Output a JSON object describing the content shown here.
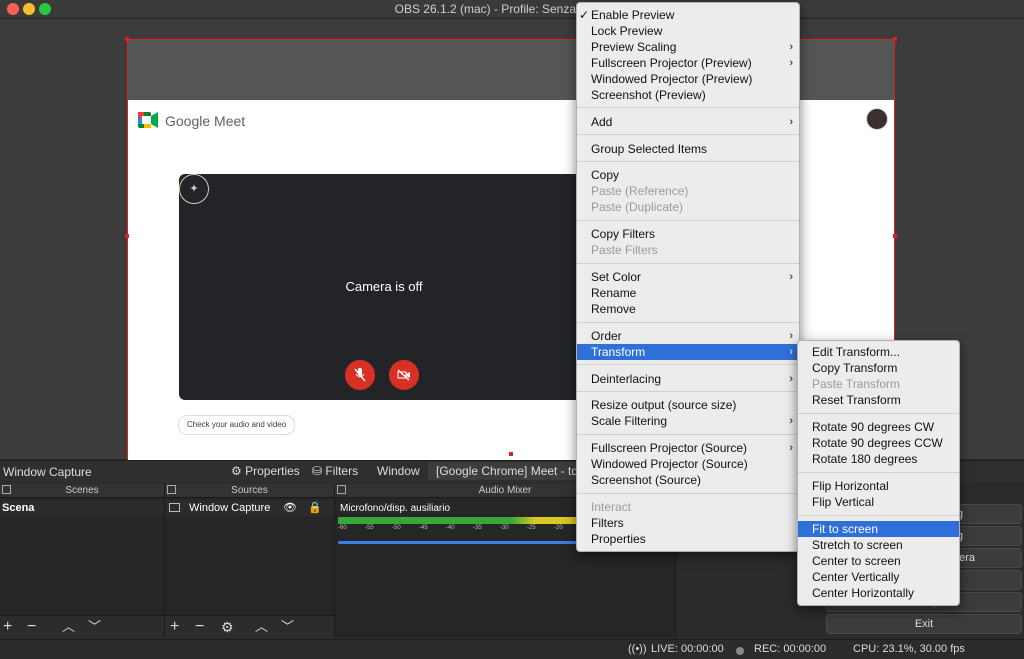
{
  "window": {
    "title": "OBS 26.1.2 (mac) - Profile: Senza titolo - Sc"
  },
  "preview": {
    "meet_name": "Google Meet",
    "camera_off": "Camera is off",
    "check_audio": "Check your audio and video"
  },
  "toolbar": {
    "source_name": "Window Capture",
    "properties": "Properties",
    "filters": "Filters",
    "window_label": "Window",
    "window_value": "[Google Chrome] Meet - td"
  },
  "scenes": {
    "header": "Scenes",
    "items": [
      "Scena"
    ]
  },
  "sources": {
    "header": "Sources",
    "items": [
      "Window Capture"
    ]
  },
  "audio": {
    "header": "Audio Mixer",
    "channel": "Microfono/disp. ausiliario",
    "ticks": [
      "-60",
      "-55",
      "-50",
      "-45",
      "-40",
      "-35",
      "-30",
      "-25",
      "-20"
    ]
  },
  "controls": {
    "btn1": "g",
    "btn2": "g",
    "btn3": "nera",
    "btn4": "",
    "btn5": "Settings",
    "exit": "Exit"
  },
  "status": {
    "live": "LIVE: 00:00:00",
    "rec": "REC: 00:00:00",
    "cpu": "CPU: 23.1%, 30.00 fps"
  },
  "context_menu": {
    "enable_preview": "Enable Preview",
    "lock_preview": "Lock Preview",
    "preview_scaling": "Preview Scaling",
    "fullscreen_preview": "Fullscreen Projector (Preview)",
    "windowed_preview": "Windowed Projector (Preview)",
    "screenshot_preview": "Screenshot (Preview)",
    "add": "Add",
    "group": "Group Selected Items",
    "copy": "Copy",
    "paste_ref": "Paste (Reference)",
    "paste_dup": "Paste (Duplicate)",
    "copy_filters": "Copy Filters",
    "paste_filters": "Paste Filters",
    "set_color": "Set Color",
    "rename": "Rename",
    "remove": "Remove",
    "order": "Order",
    "transform": "Transform",
    "deinterlacing": "Deinterlacing",
    "resize_output": "Resize output (source size)",
    "scale_filtering": "Scale Filtering",
    "fullscreen_source": "Fullscreen Projector (Source)",
    "windowed_source": "Windowed Projector (Source)",
    "screenshot_source": "Screenshot (Source)",
    "interact": "Interact",
    "filters": "Filters",
    "properties": "Properties"
  },
  "transform_menu": {
    "edit": "Edit Transform...",
    "copy": "Copy Transform",
    "paste": "Paste Transform",
    "reset": "Reset Transform",
    "rot_cw": "Rotate 90 degrees CW",
    "rot_ccw": "Rotate 90 degrees CCW",
    "rot_180": "Rotate 180 degrees",
    "flip_h": "Flip Horizontal",
    "flip_v": "Flip Vertical",
    "fit": "Fit to screen",
    "stretch": "Stretch to screen",
    "center": "Center to screen",
    "center_v": "Center Vertically",
    "center_h": "Center Horizontally"
  }
}
